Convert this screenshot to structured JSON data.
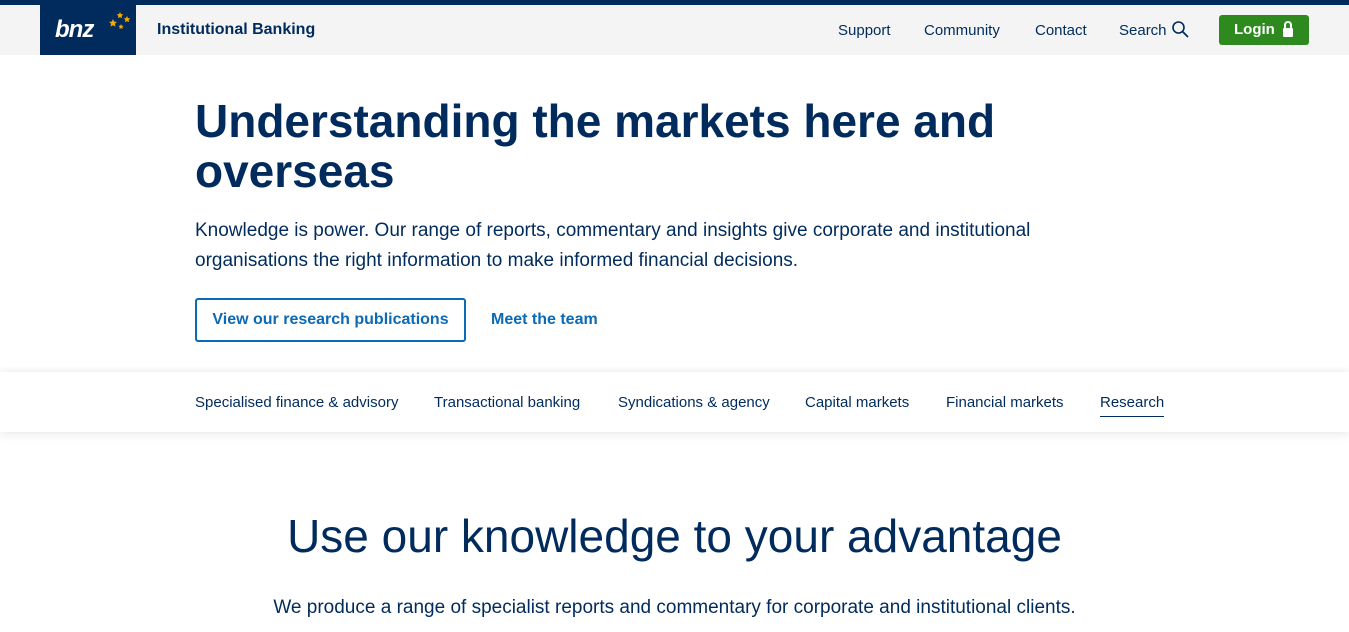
{
  "header": {
    "logo_text": "bnz",
    "site_name": "Institutional Banking",
    "nav": [
      {
        "label": "Support"
      },
      {
        "label": "Community"
      },
      {
        "label": "Contact"
      },
      {
        "label": "Search",
        "icon": "search-icon"
      }
    ],
    "login": {
      "label": "Login",
      "icon": "lock-icon",
      "color": "#2e8a1f"
    }
  },
  "hero": {
    "title": "Understanding the markets here and overseas",
    "intro": "Knowledge is power. Our range of reports, commentary and insights give corporate and institutional organisations the right information to make informed financial decisions.",
    "primary_button": "View our research publications",
    "secondary_link": "Meet the team"
  },
  "subnav": {
    "items": [
      {
        "label": "Specialised finance & advisory"
      },
      {
        "label": "Transactional banking"
      },
      {
        "label": "Syndications & agency"
      },
      {
        "label": "Capital markets"
      },
      {
        "label": "Financial markets"
      },
      {
        "label": "Research",
        "active": true
      }
    ]
  },
  "section": {
    "title": "Use our knowledge to your advantage",
    "text": "We produce a range of specialist reports and commentary for corporate and institutional clients."
  },
  "colors": {
    "brand_navy": "#002b5c",
    "link_blue": "#0a6ab5",
    "login_green": "#2e8a1f",
    "star_gold": "#f5a800"
  }
}
